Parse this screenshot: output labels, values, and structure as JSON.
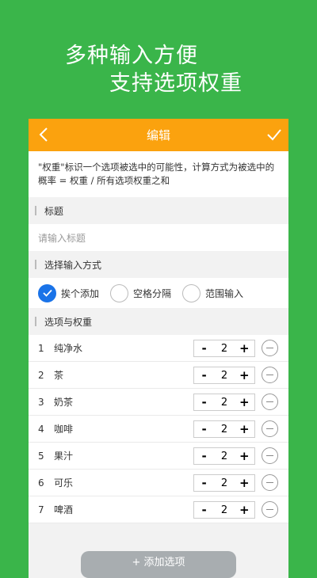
{
  "promo": {
    "line1": "多种输入方便",
    "line2": "支持选项权重"
  },
  "header": {
    "title": "编辑"
  },
  "description": "\"权重\"标识一个选项被选中的可能性，计算方式为被选中的概率 = 权重 / 所有选项权重之和",
  "sections": {
    "title_label": "标题",
    "mode_label": "选择输入方式",
    "options_label": "选项与权重"
  },
  "title_input": {
    "placeholder": "请输入标题"
  },
  "modes": [
    {
      "label": "挨个添加",
      "selected": true
    },
    {
      "label": "空格分隔",
      "selected": false
    },
    {
      "label": "范围输入",
      "selected": false
    }
  ],
  "stepper": {
    "minus": "-",
    "plus": "+"
  },
  "options": [
    {
      "num": "1",
      "name": "纯净水",
      "weight": "2"
    },
    {
      "num": "2",
      "name": "茶",
      "weight": "2"
    },
    {
      "num": "3",
      "name": "奶茶",
      "weight": "2"
    },
    {
      "num": "4",
      "name": "咖啡",
      "weight": "2"
    },
    {
      "num": "5",
      "name": "果汁",
      "weight": "2"
    },
    {
      "num": "6",
      "name": "可乐",
      "weight": "2"
    },
    {
      "num": "7",
      "name": "啤酒",
      "weight": "2"
    }
  ],
  "add_button": {
    "label": "+ 添加选项"
  },
  "colors": {
    "background": "#3ab54a",
    "header": "#fba20e",
    "radio_selected": "#1a73e8"
  }
}
